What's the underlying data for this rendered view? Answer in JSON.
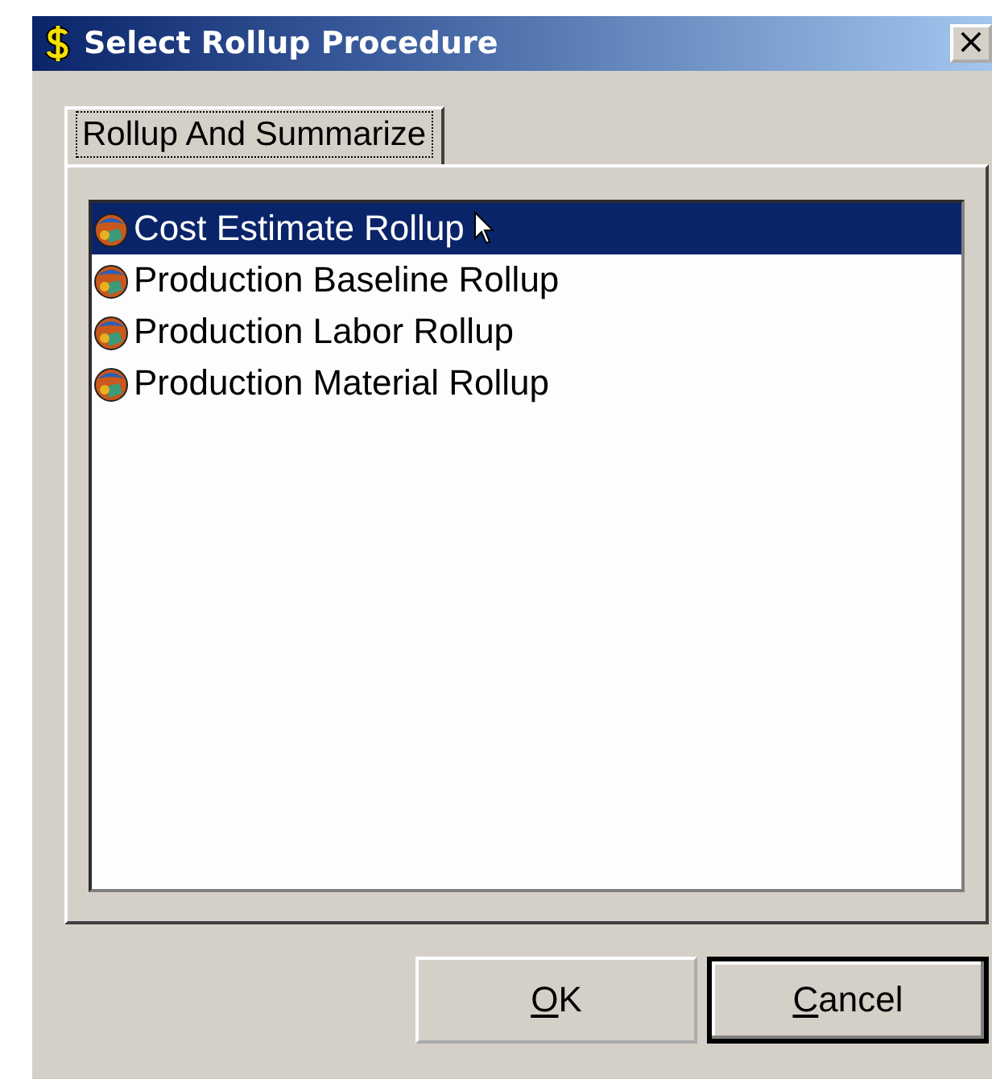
{
  "window": {
    "title": "Select Rollup Procedure",
    "close": "×"
  },
  "tabs": [
    {
      "label": "Rollup And Summarize",
      "selected": true
    }
  ],
  "procedures": [
    {
      "label": "Cost Estimate Rollup",
      "selected": true
    },
    {
      "label": "Production Baseline Rollup",
      "selected": false
    },
    {
      "label": "Production Labor Rollup",
      "selected": false
    },
    {
      "label": "Production Material Rollup",
      "selected": false
    }
  ],
  "buttons": [
    {
      "label": "OK",
      "mnemonic": true,
      "default": false
    },
    {
      "label": "Cancel",
      "mnemonic": true,
      "default": true
    }
  ]
}
